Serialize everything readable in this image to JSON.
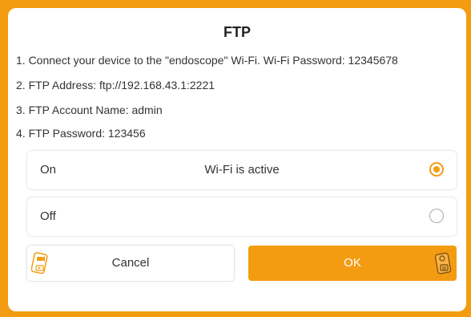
{
  "dialog": {
    "title": "FTP",
    "lines": [
      "1. Connect your device to the \"endoscope\" Wi-Fi. Wi-Fi Password: 12345678",
      "2. FTP Address: ftp://192.168.43.1:2221",
      "3. FTP Account Name: admin",
      "4. FTP Password: 123456"
    ],
    "options": [
      {
        "label": "On",
        "status": "Wi-Fi is active",
        "selected": true
      },
      {
        "label": "Off",
        "status": "",
        "selected": false
      }
    ],
    "buttons": {
      "cancel": "Cancel",
      "ok": "OK"
    }
  },
  "colors": {
    "accent": "#f39c12",
    "background": "#ffffff"
  },
  "icons": {
    "cancel": "video-camera-card-icon",
    "ok": "camera-card-icon"
  }
}
